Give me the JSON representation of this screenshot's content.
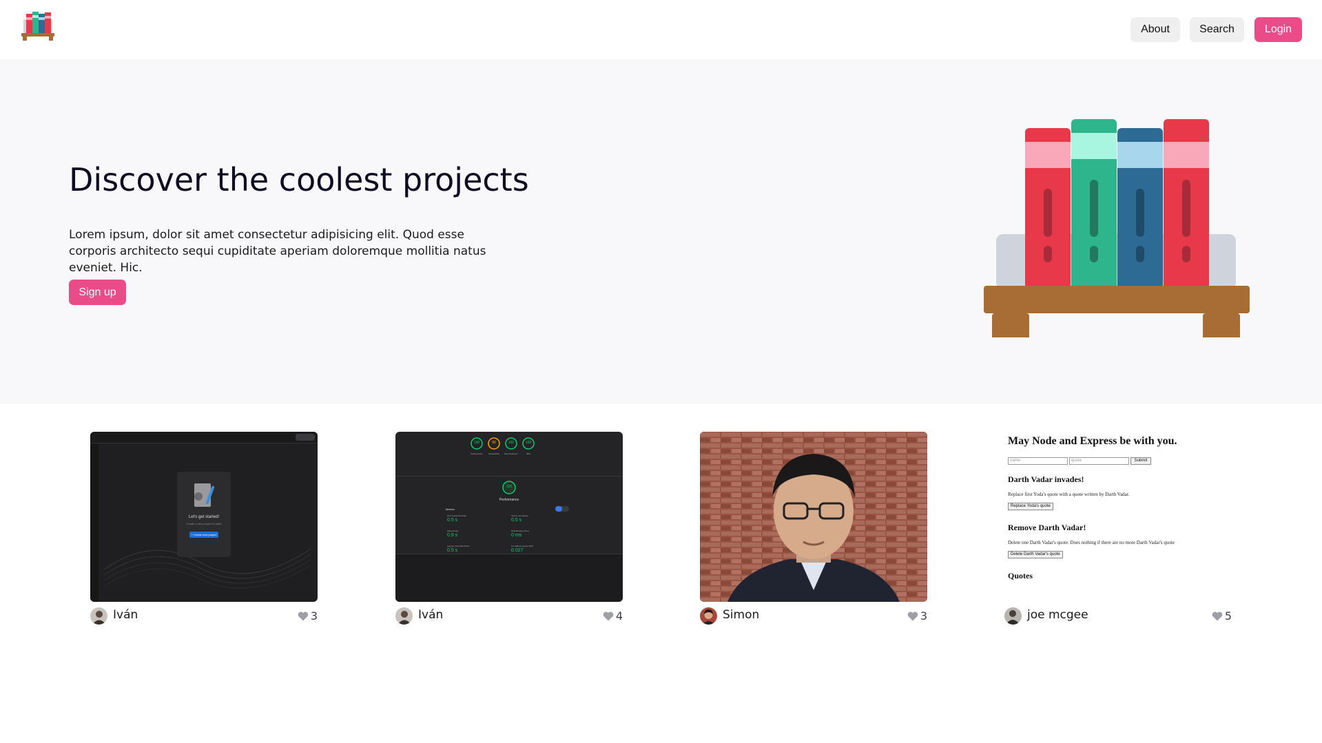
{
  "nav": {
    "about_label": "About",
    "search_label": "Search",
    "login_label": "Login"
  },
  "hero": {
    "title": "Discover the coolest projects",
    "description": "Lorem ipsum, dolor sit amet consectetur adipisicing elit. Quod esse corporis architecto sequi cupiditate aperiam doloremque mollitia natus eveniet. Hic.",
    "signup_label": "Sign up"
  },
  "colors": {
    "accent": "#ea4c89",
    "hero_bg": "#f8f8fa",
    "button_bg": "#efefef"
  },
  "cards": [
    {
      "author": "Iván",
      "likes": "3",
      "thumb": {
        "title": "Let's get started!",
        "subtitle": "Create a new project to start!",
        "button": "+ Create new project"
      }
    },
    {
      "author": "Iván",
      "likes": "4",
      "thumb": {
        "scores": [
          "100",
          "88",
          "100",
          "100"
        ],
        "score_labels": [
          "Performance",
          "Accessibility",
          "Best Practices",
          "SEO"
        ],
        "main_score": "100",
        "main_label": "Performance",
        "metrics_title": "Metrics",
        "metrics": [
          {
            "label": "First Contentful Paint",
            "value": "0.5 s"
          },
          {
            "label": "Time to Interactive",
            "value": "0.5 s"
          },
          {
            "label": "Speed Index",
            "value": "0.9 s"
          },
          {
            "label": "Total Blocking Time",
            "value": "0 ms"
          },
          {
            "label": "Largest Contentful Paint",
            "value": "0.5 s"
          },
          {
            "label": "Cumulative Layout Shift",
            "value": "0.027"
          }
        ]
      }
    },
    {
      "author": "Simon",
      "likes": "3"
    },
    {
      "author": "joe mcgee",
      "likes": "5",
      "thumb": {
        "heading": "May Node and Express be with you.",
        "name_placeholder": "name",
        "quote_placeholder": "quote",
        "submit": "Submit",
        "section1_title": "Darth Vadar invades!",
        "section1_text": "Replace first Yoda's quote with a quote written by Darth Vadar.",
        "section1_button": "Replace Yoda's quote",
        "section2_title": "Remove Darth Vadar!",
        "section2_text": "Delete one Darth Vadar's quote. Does nothing if there are no more Darth Vadar's quote",
        "section2_button": "Delete Darth Vadar's quote",
        "section3_title": "Quotes"
      }
    }
  ],
  "icons": {
    "logo": "bookshelf-icon",
    "like": "heart-icon"
  }
}
